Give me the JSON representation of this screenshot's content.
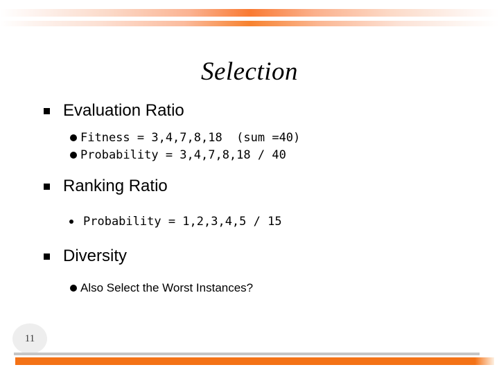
{
  "slide": {
    "title": "Selection",
    "page_number": "11",
    "accent_color": "#f47216",
    "header_gradient_color": "#f97a33",
    "badge_color": "#eeeeee",
    "rule_color": "#c6c6c6"
  },
  "bullets": [
    {
      "label": "Evaluation Ratio",
      "bullet_icon": "square-bullet-icon",
      "children": [
        {
          "text": "Fitness = 3,4,7,8,18  (sum =40)",
          "bullet_icon": "round-bullet-icon",
          "style": "mono"
        },
        {
          "text": "Probability = 3,4,7,8,18 / 40",
          "bullet_icon": "round-bullet-icon",
          "style": "mono"
        }
      ]
    },
    {
      "label": "Ranking Ratio",
      "bullet_icon": "square-bullet-icon",
      "children": [
        {
          "text": "Probability = 1,2,3,4,5 / 15",
          "bullet_icon": "small-round-bullet-icon",
          "style": "mono-indented"
        }
      ]
    },
    {
      "label": "Diversity",
      "bullet_icon": "square-bullet-icon",
      "children": [
        {
          "text": "Also Select the Worst Instances?",
          "bullet_icon": "round-bullet-icon",
          "style": "sans"
        }
      ]
    }
  ]
}
